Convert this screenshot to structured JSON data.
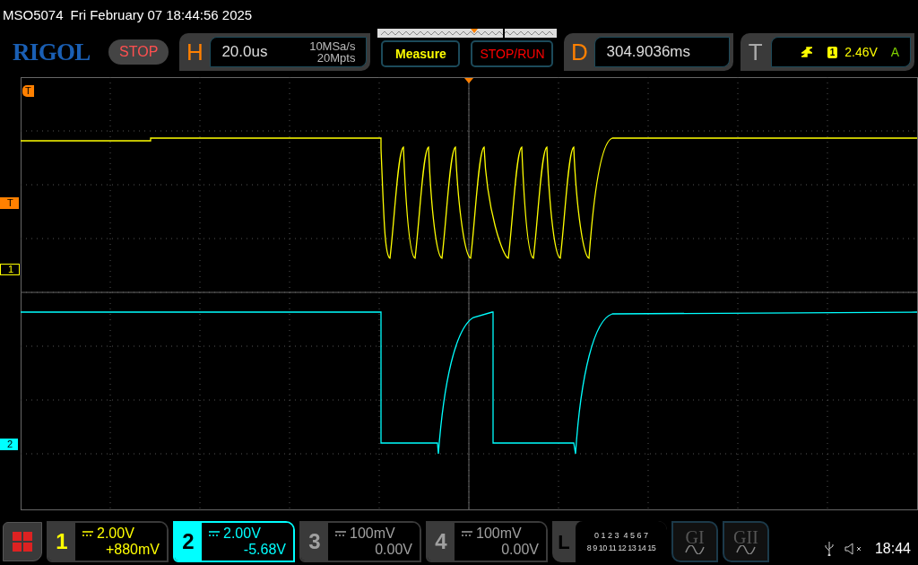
{
  "status_line": {
    "model": "MSO5074",
    "datetime": "Fri February 07 18:44:56 2025"
  },
  "toolbar": {
    "logo": "RIGOL",
    "run_state": "STOP",
    "horizontal": {
      "letter": "H",
      "timebase": "20.0us",
      "sample_rate": "10MSa/s",
      "memory_depth": "20Mpts"
    },
    "measure_button": "Measure",
    "stop_run_button": "STOP/RUN",
    "delay": {
      "letter": "D",
      "value": "304.9036ms"
    },
    "trigger": {
      "letter": "T",
      "source": "1",
      "level": "2.46V",
      "mode": "A"
    }
  },
  "markers": {
    "trigger_position": "T",
    "trigger_level": "T",
    "channel_1": "1",
    "channel_2": "2"
  },
  "channels": [
    {
      "number": "1",
      "scale": "2.00V",
      "offset": "+880mV",
      "color": "#ffff00",
      "selected": false
    },
    {
      "number": "2",
      "scale": "2.00V",
      "offset": "-5.68V",
      "color": "#00ffff",
      "selected": true
    },
    {
      "number": "3",
      "scale": "100mV",
      "offset": "0.00V",
      "color": "#a0a0a0",
      "selected": false
    },
    {
      "number": "4",
      "scale": "100mV",
      "offset": "0.00V",
      "color": "#a0a0a0",
      "selected": false
    }
  ],
  "logic": {
    "letter": "L",
    "row_1": "0 1 2 3  4 5 6 7",
    "row_2": "8 9 10 11 12 13 14 15"
  },
  "generators": [
    {
      "label": "GI"
    },
    {
      "label": "GII"
    }
  ],
  "clock": "18:44"
}
